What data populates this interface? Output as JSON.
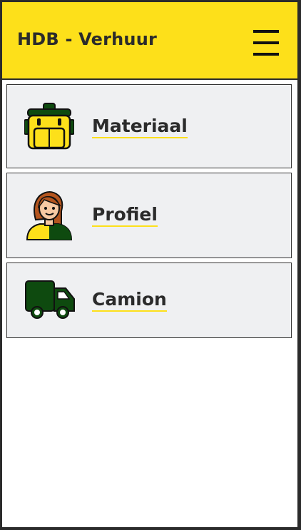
{
  "header": {
    "title": "HDB - Verhuur",
    "menu_icon": "hamburger-menu-icon"
  },
  "colors": {
    "brand_yellow": "#fde01a",
    "brand_green": "#0e4a0f",
    "card_bg": "#eff0f2",
    "text": "#2b2b2b"
  },
  "menu": {
    "items": [
      {
        "label": "Materiaal",
        "icon": "backpack-icon"
      },
      {
        "label": "Profiel",
        "icon": "user-avatar-icon"
      },
      {
        "label": "Camion",
        "icon": "truck-icon"
      }
    ]
  }
}
